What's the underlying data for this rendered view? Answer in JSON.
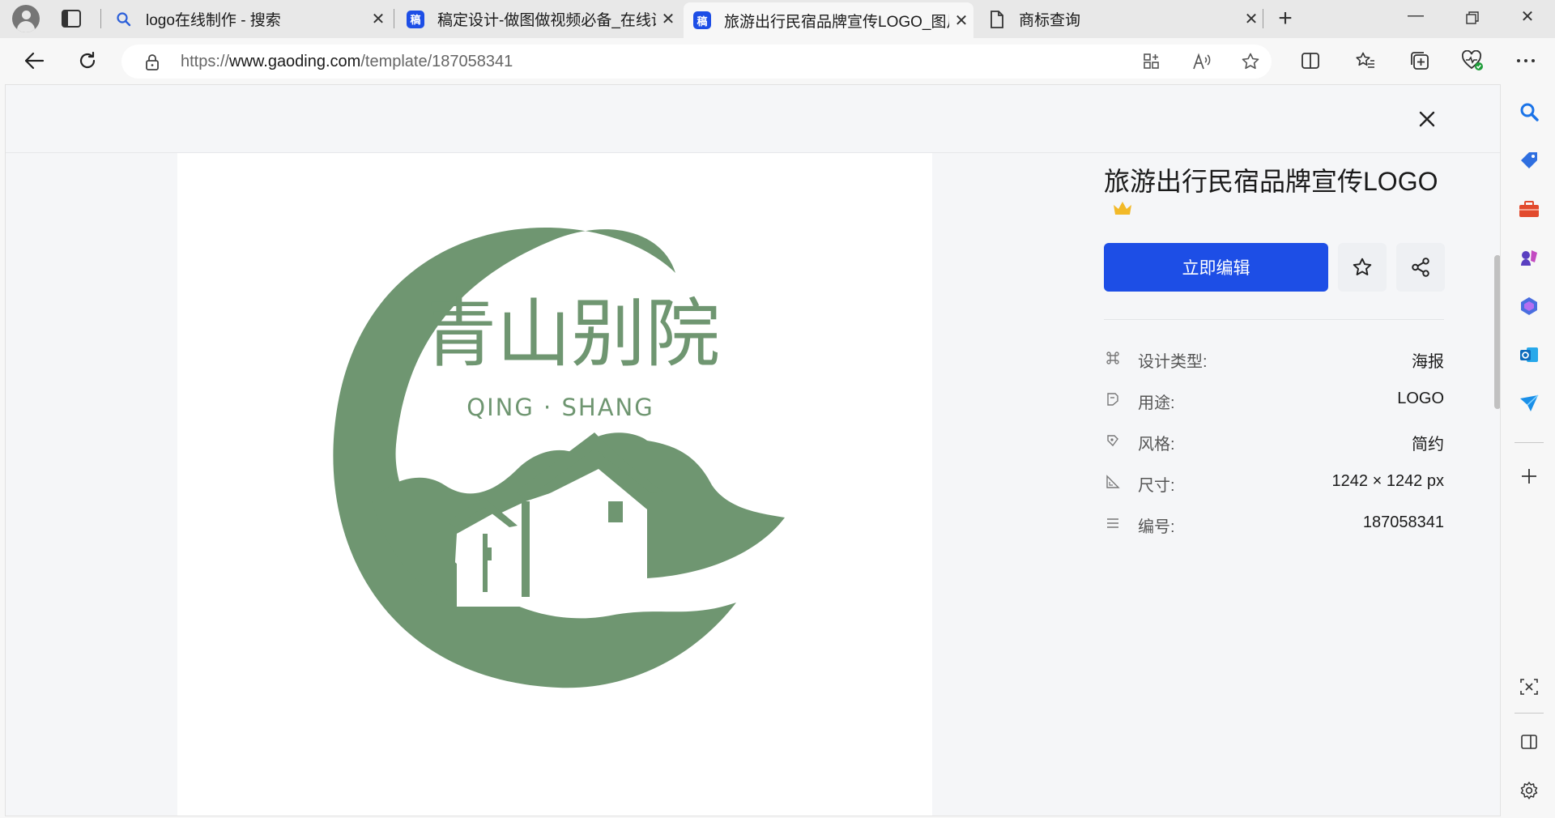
{
  "tabs": [
    {
      "title": "logo在线制作 - 搜索",
      "icon": "search-icon"
    },
    {
      "title": "稿定设计-做图做视频必备_在线设计",
      "icon": "gaoding-favicon",
      "favicon_text": "稿"
    },
    {
      "title": "旅游出行民宿品牌宣传LOGO_图片",
      "icon": "gaoding-favicon",
      "favicon_text": "稿",
      "active": true
    },
    {
      "title": "商标查询",
      "icon": "page-icon"
    }
  ],
  "address": {
    "url_prefix": "https://",
    "url_domain": "www.gaoding.com",
    "url_path": "/template/187058341"
  },
  "logo": {
    "brand_cn": "青山别院",
    "brand_en": "QING · SHANG",
    "color": "#6f9671"
  },
  "details": {
    "title": "旅游出行民宿品牌宣传LOGO",
    "edit_label": "立即编辑",
    "rows": [
      {
        "label": "设计类型:",
        "value": "海报",
        "icon": "command-icon"
      },
      {
        "label": "用途:",
        "value": "LOGO",
        "icon": "note-icon"
      },
      {
        "label": "风格:",
        "value": "简约",
        "icon": "palette-icon"
      },
      {
        "label": "尺寸:",
        "value": "1242 × 1242 px",
        "icon": "ruler-icon"
      },
      {
        "label": "编号:",
        "value": "187058341",
        "icon": "list-icon"
      }
    ]
  },
  "colors": {
    "accent": "#1d4ee6",
    "logo_green": "#6f9671"
  }
}
